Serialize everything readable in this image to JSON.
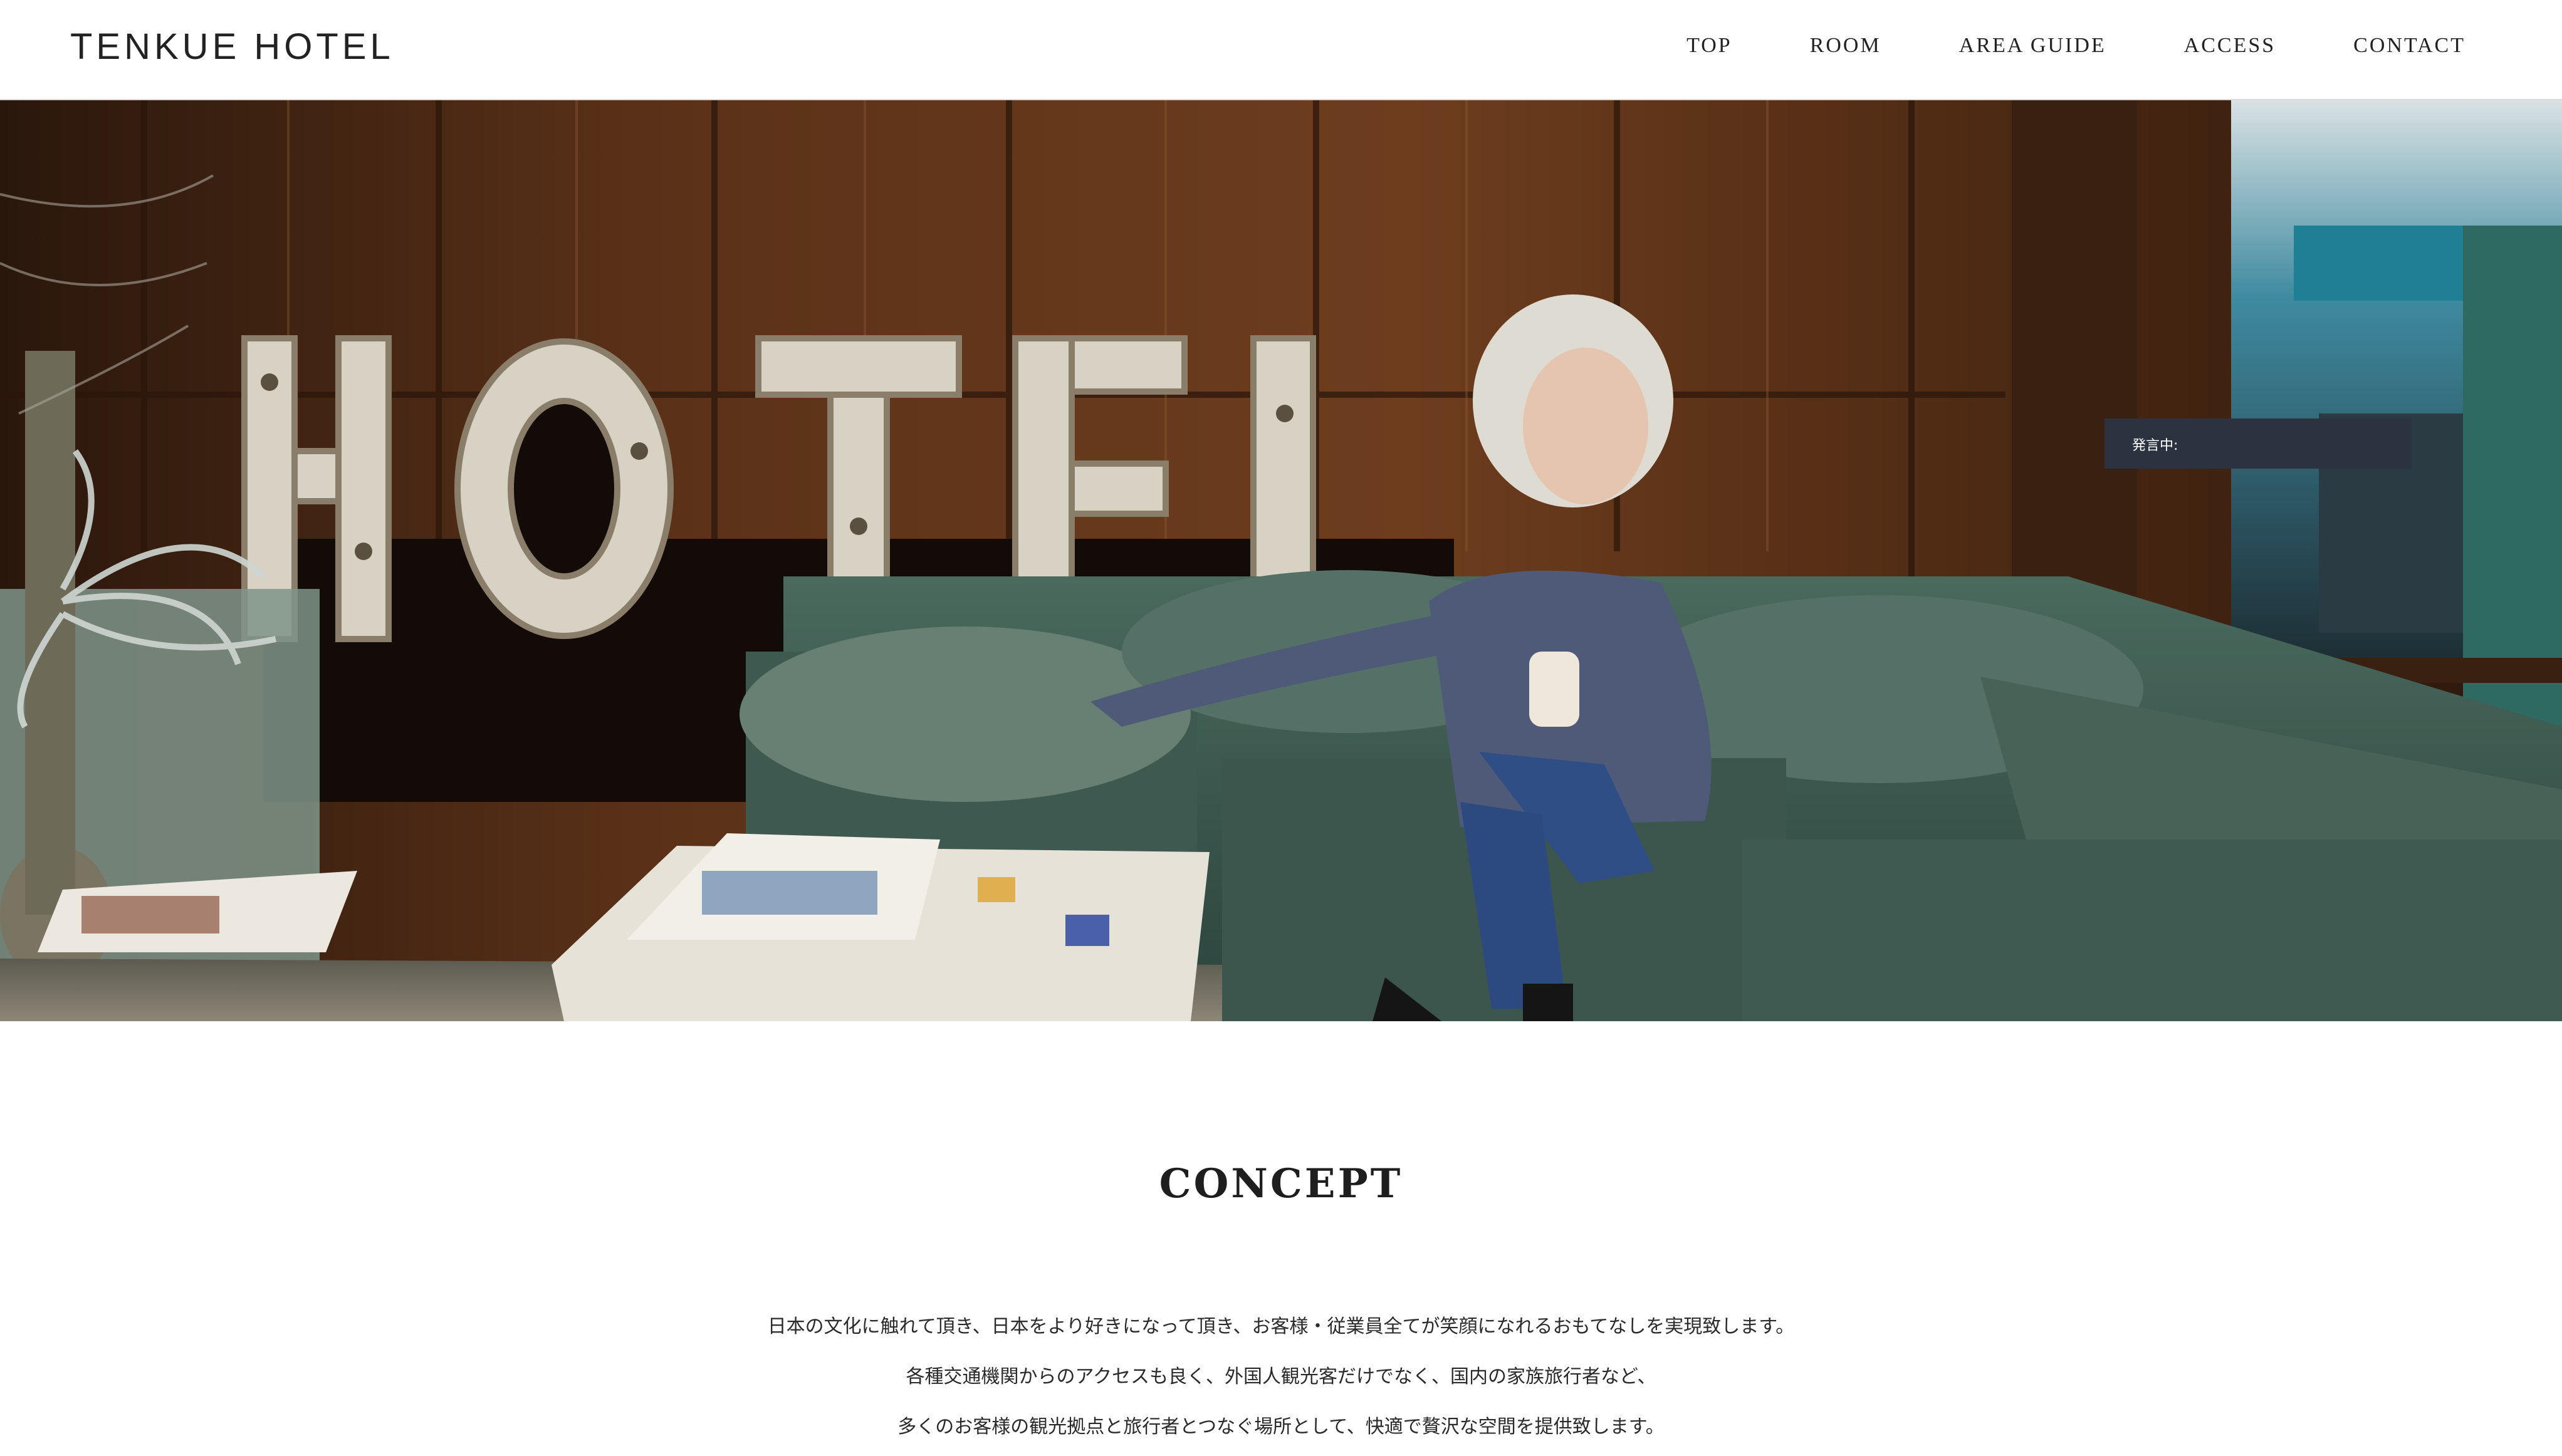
{
  "header": {
    "logo": "TENKUE HOTEL",
    "nav": [
      {
        "label": "TOP"
      },
      {
        "label": "ROOM"
      },
      {
        "label": "AREA GUIDE"
      },
      {
        "label": "ACCESS"
      },
      {
        "label": "CONTACT"
      }
    ]
  },
  "hero": {
    "sign_text": "HOTEL",
    "speech_label": "発言中:"
  },
  "concept": {
    "title": "CONCEPT",
    "lines": [
      "日本の文化に触れて頂き、日本をより好きになって頂き、お客様・従業員全てが笑顔になれるおもてなしを実現致します。",
      "各種交通機関からのアクセスも良く、外国人観光客だけでなく、国内の家族旅行者など、",
      "多くのお客様の観光拠点と旅行者とつなぐ場所として、快適で贅沢な空間を提供致します。"
    ]
  }
}
